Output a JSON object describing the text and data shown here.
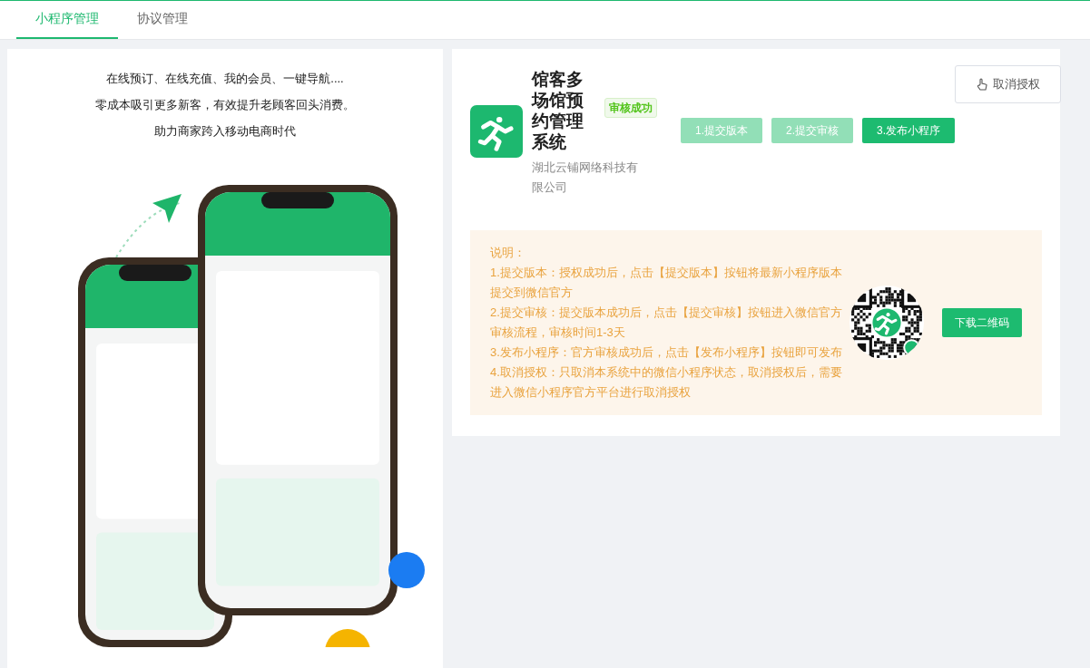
{
  "tabs": [
    {
      "label": "小程序管理",
      "selected": true
    },
    {
      "label": "协议管理",
      "selected": false
    }
  ],
  "promo": {
    "lines": [
      "在线预订、在线充值、我的会员、一键导航....",
      "零成本吸引更多新客，有效提升老顾客回头消费。",
      "助力商家跨入移动电商时代"
    ],
    "image": {
      "kind": "picture"
    }
  },
  "app": {
    "name": "馆客多场馆预约管理系统",
    "company": "湖北云铺网络科技有限公司",
    "status": "审核成功"
  },
  "steps": [
    {
      "label": "1.提交版本",
      "selected": false
    },
    {
      "label": "2.提交审核",
      "selected": false
    },
    {
      "label": "3.发布小程序",
      "selected": true
    }
  ],
  "revoke_button": "取消授权",
  "notes": {
    "title": "说明：",
    "items": [
      "1.提交版本：授权成功后，点击【提交版本】按钮将最新小程序版本提交到微信官方",
      "2.提交审核：提交版本成功后，点击【提交审核】按钮进入微信官方审核流程，审核时间1-3天",
      "3.发布小程序：官方审核成功后，点击【发布小程序】按钮即可发布",
      "4.取消授权：只取消本系统中的微信小程序状态，取消授权后，需要进入微信小程序官方平台进行取消授权"
    ]
  },
  "download_button": "下载二维码"
}
